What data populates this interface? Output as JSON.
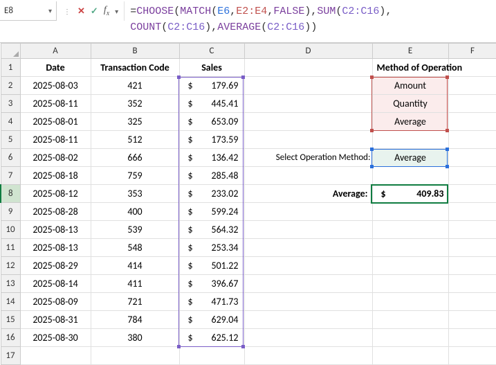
{
  "nameBox": "E8",
  "formula_parts": {
    "eq": "=",
    "choose": "CHOOSE",
    "lp1": "(",
    "match": "MATCH",
    "lp2": "(",
    "e6": "E6",
    "c1": ",",
    "e2e4": "E2:E4",
    "c2": ",",
    "false": "FALSE",
    "rp1": ")",
    "c3": ",",
    "sum": "SUM",
    "lp3": "(",
    "c2c16a": "C2:C16",
    "rp2": ")",
    "c4": ",",
    "br": "",
    "count": "COUNT",
    "lp4": "(",
    "c2c16b": "C2:C16",
    "rp3": ")",
    "c5": ",",
    "avg": "AVERAGE",
    "lp5": "(",
    "c2c16c": "C2:C16",
    "rp4": ")",
    "rp5": ")"
  },
  "columns": [
    "A",
    "B",
    "C",
    "D",
    "E",
    "F"
  ],
  "headers": {
    "date": "Date",
    "tcode": "Transaction Code",
    "sales": "Sales",
    "method": "Method of Operation"
  },
  "rows": [
    {
      "n": 1
    },
    {
      "n": 2,
      "date": "2025-08-03",
      "code": "421",
      "sales": "179.69",
      "e": "Amount"
    },
    {
      "n": 3,
      "date": "2025-08-11",
      "code": "352",
      "sales": "445.41",
      "e": "Quantity"
    },
    {
      "n": 4,
      "date": "2025-08-01",
      "code": "325",
      "sales": "653.09",
      "e": "Average"
    },
    {
      "n": 5,
      "date": "2025-08-11",
      "code": "512",
      "sales": "173.59"
    },
    {
      "n": 6,
      "date": "2025-08-02",
      "code": "666",
      "sales": "136.42",
      "d": "Select Operation Method:",
      "e": "Average"
    },
    {
      "n": 7,
      "date": "2025-08-18",
      "code": "759",
      "sales": "285.48"
    },
    {
      "n": 8,
      "date": "2025-08-12",
      "code": "353",
      "sales": "233.02",
      "d": "Average:",
      "e": "409.83"
    },
    {
      "n": 9,
      "date": "2025-08-28",
      "code": "400",
      "sales": "599.24"
    },
    {
      "n": 10,
      "date": "2025-08-13",
      "code": "539",
      "sales": "564.32"
    },
    {
      "n": 11,
      "date": "2025-08-13",
      "code": "548",
      "sales": "253.34"
    },
    {
      "n": 12,
      "date": "2025-08-29",
      "code": "414",
      "sales": "501.22"
    },
    {
      "n": 13,
      "date": "2025-08-14",
      "code": "411",
      "sales": "396.67"
    },
    {
      "n": 14,
      "date": "2025-08-09",
      "code": "721",
      "sales": "471.73"
    },
    {
      "n": 15,
      "date": "2025-08-31",
      "code": "784",
      "sales": "629.04"
    },
    {
      "n": 16,
      "date": "2025-08-30",
      "code": "380",
      "sales": "625.12"
    },
    {
      "n": 17
    }
  ],
  "dollar": "$"
}
